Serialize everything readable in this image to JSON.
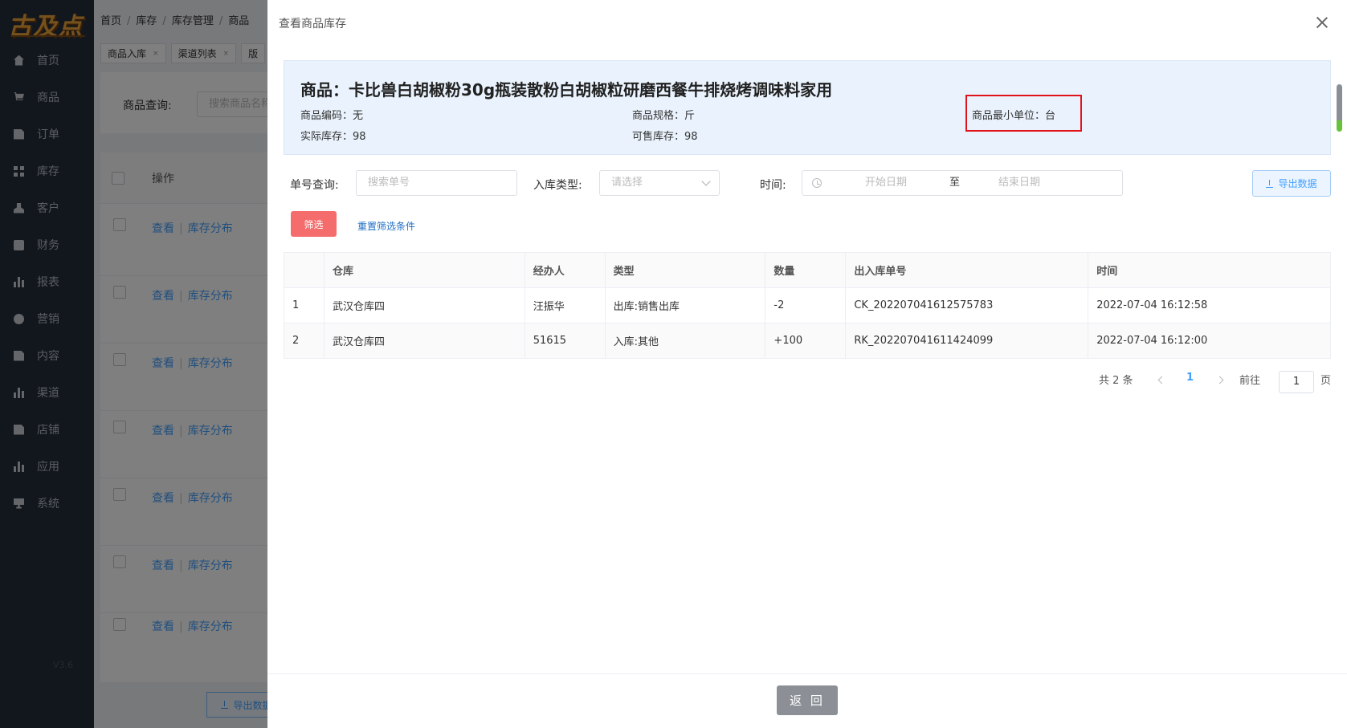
{
  "sidebar": {
    "logo": "古及点",
    "version": "V3.6",
    "items": [
      {
        "label": "首页",
        "icon": "home-icon"
      },
      {
        "label": "商品",
        "icon": "cart-icon"
      },
      {
        "label": "订单",
        "icon": "document-icon"
      },
      {
        "label": "库存",
        "icon": "grid-icon"
      },
      {
        "label": "客户",
        "icon": "user-icon"
      },
      {
        "label": "财务",
        "icon": "wallet-icon"
      },
      {
        "label": "报表",
        "icon": "bar-chart-icon"
      },
      {
        "label": "营销",
        "icon": "coin-icon"
      },
      {
        "label": "内容",
        "icon": "document-icon"
      },
      {
        "label": "渠道",
        "icon": "bar-chart-icon"
      },
      {
        "label": "店铺",
        "icon": "document-icon"
      },
      {
        "label": "应用",
        "icon": "bar-chart-icon"
      },
      {
        "label": "系统",
        "icon": "monitor-icon"
      }
    ]
  },
  "background": {
    "breadcrumb": [
      "首页",
      "库存",
      "库存管理",
      "商品"
    ],
    "tabs": [
      "商品入库",
      "渠道列表",
      "版"
    ],
    "search_label": "商品查询:",
    "search_placeholder": "搜索商品名称",
    "op_header": "操作",
    "row_view": "查看",
    "row_dist": "库存分布",
    "export_label": "导出数据"
  },
  "drawer": {
    "title": "查看商品库存",
    "product": {
      "name": "商品：卡比兽白胡椒粉30g瓶装散粉白胡椒粒研磨西餐牛排烧烤调味料家用",
      "code": "商品编码：无",
      "spec": "商品规格：斤",
      "min_unit": "商品最小单位：台",
      "actual_stock": "实际库存：98",
      "sellable_stock": "可售库存：98"
    },
    "filters": {
      "order_label": "单号查询:",
      "order_placeholder": "搜索单号",
      "type_label": "入库类型:",
      "type_placeholder": "请选择",
      "time_label": "时间:",
      "start_placeholder": "开始日期",
      "range_sep": "至",
      "end_placeholder": "结束日期",
      "export_label": "导出数据",
      "filter_button": "筛选",
      "reset_link": "重置筛选条件"
    },
    "table": {
      "headers": [
        "",
        "仓库",
        "经办人",
        "类型",
        "数量",
        "出入库单号",
        "时间"
      ],
      "rows": [
        [
          "1",
          "武汉仓库四",
          "汪振华",
          "出库:销售出库",
          "-2",
          "CK_202207041612575783",
          "2022-07-04 16:12:58"
        ],
        [
          "2",
          "武汉仓库四",
          "51615",
          "入库:其他",
          "+100",
          "RK_202207041611424099",
          "2022-07-04 16:12:00"
        ]
      ]
    },
    "pagination": {
      "total": "共 2 条",
      "current": "1",
      "goto_label": "前往",
      "goto_value": "1",
      "page_suffix": "页"
    },
    "back_button": "返 回"
  },
  "colors": {
    "sidebar_bg": "#242d3b",
    "accent": "#409eff",
    "danger": "#f56c6c",
    "success": "#67c23a",
    "highlight_border": "#e0131a"
  }
}
